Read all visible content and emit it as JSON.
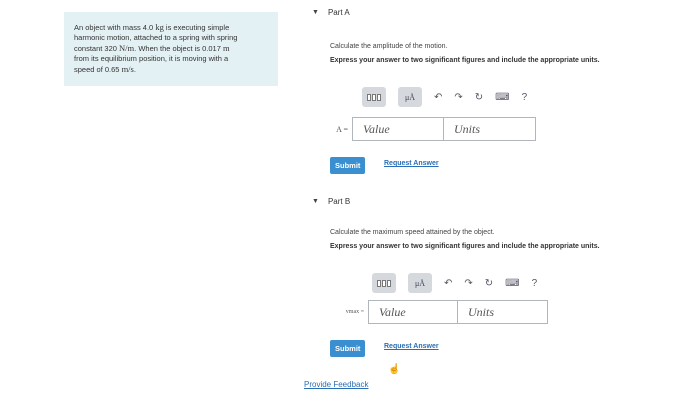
{
  "problem": {
    "line1_a": "An object with mass 4.0",
    "line1_unit": "kg",
    "line1_b": "is executing simple",
    "line2": "harmonic motion, attached to a spring with spring",
    "line3_a": "constant 320",
    "line3_unit": "N/m",
    "line3_b": ". When the object is 0.017",
    "line3_unit2": "m",
    "line4": "from its equilibrium position, it is moving with a",
    "line5_a": "speed of 0.65",
    "line5_unit": "m/s",
    "line5_b": "."
  },
  "partA": {
    "title": "Part A",
    "question": "Calculate the amplitude of the motion.",
    "instruction": "Express your answer to two significant figures and include the appropriate units.",
    "var_label": "A =",
    "value_placeholder": "Value",
    "units_placeholder": "Units",
    "submit": "Submit",
    "request": "Request Answer"
  },
  "partB": {
    "title": "Part B",
    "question": "Calculate the maximum speed attained by the object.",
    "instruction": "Express your answer to two significant figures and include the appropriate units.",
    "var_label": "vmax =",
    "value_placeholder": "Value",
    "units_placeholder": "Units",
    "submit": "Submit",
    "request": "Request Answer"
  },
  "toolbar": {
    "mu": "μÅ",
    "help": "?"
  },
  "feedback": "Provide Feedback"
}
